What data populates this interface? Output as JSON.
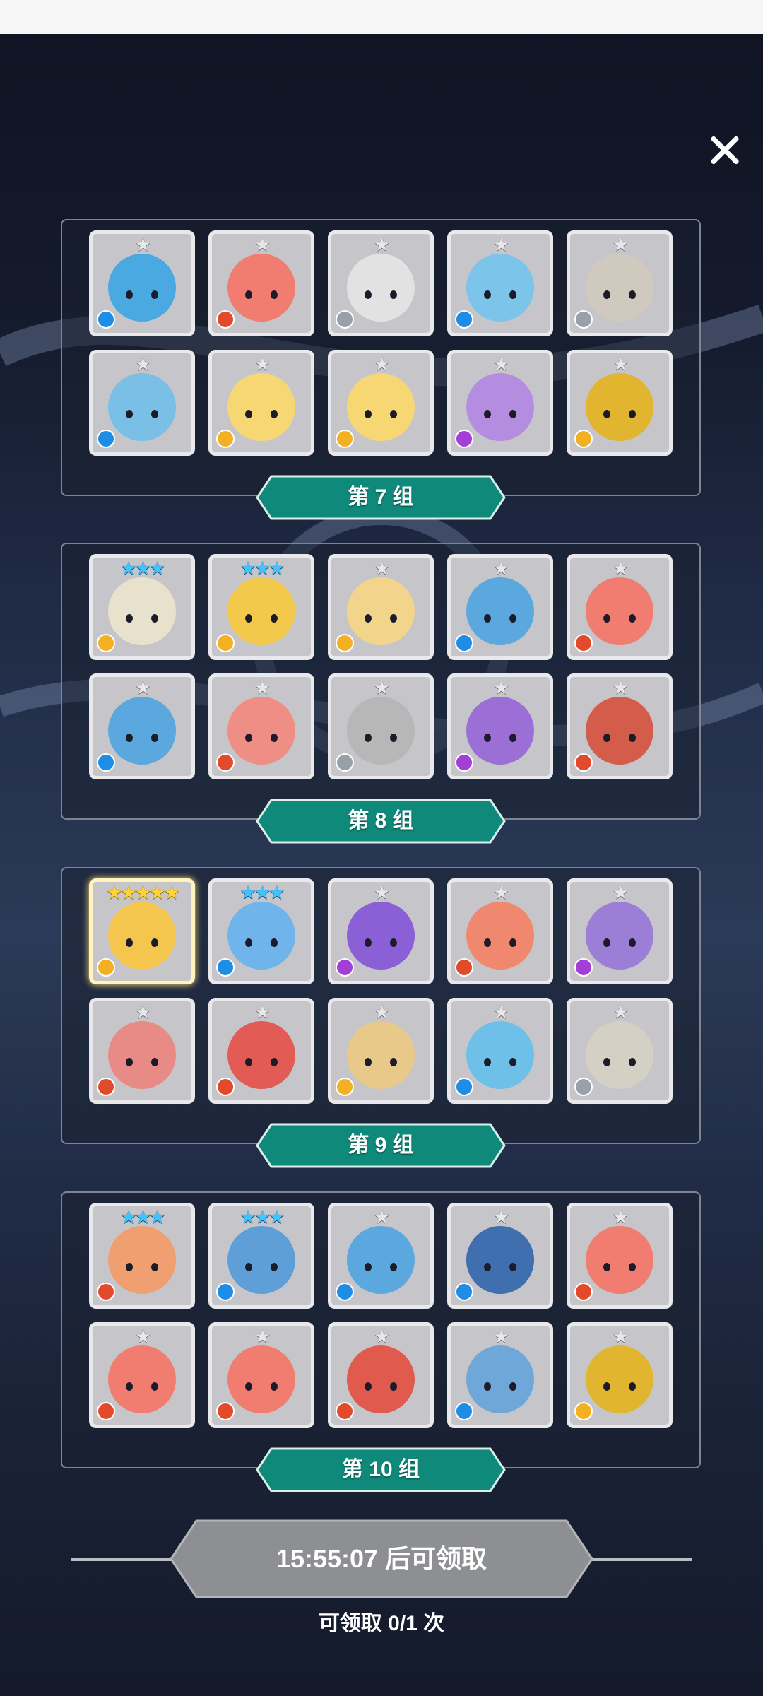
{
  "icons": {
    "close": "close-icon"
  },
  "claim": {
    "label": "15:55:07 后可领取",
    "count_text": "可领取 0/1 次"
  },
  "groups": [
    {
      "label": "第 7 组",
      "cards": [
        {
          "stars": 1,
          "star_color": "silver",
          "element": "water",
          "color": "#4aa9e0"
        },
        {
          "stars": 1,
          "star_color": "silver",
          "element": "fire",
          "color": "#f07d70"
        },
        {
          "stars": 1,
          "star_color": "silver",
          "element": "light",
          "color": "#e2e2e2"
        },
        {
          "stars": 1,
          "star_color": "silver",
          "element": "water",
          "color": "#7cc4ea"
        },
        {
          "stars": 1,
          "star_color": "silver",
          "element": "light",
          "color": "#cfcabd"
        },
        {
          "stars": 1,
          "star_color": "silver",
          "element": "water",
          "color": "#79bfe6"
        },
        {
          "stars": 1,
          "star_color": "silver",
          "element": "wind",
          "color": "#f6d774"
        },
        {
          "stars": 1,
          "star_color": "silver",
          "element": "wind",
          "color": "#f6d774"
        },
        {
          "stars": 1,
          "star_color": "silver",
          "element": "dark",
          "color": "#b58de0"
        },
        {
          "stars": 1,
          "star_color": "silver",
          "element": "wind",
          "color": "#e2b531"
        }
      ]
    },
    {
      "label": "第 8 组",
      "cards": [
        {
          "stars": 3,
          "star_color": "blue",
          "element": "wind",
          "color": "#e8e1cc"
        },
        {
          "stars": 3,
          "star_color": "blue",
          "element": "wind",
          "color": "#f2c94a"
        },
        {
          "stars": 1,
          "star_color": "silver",
          "element": "wind",
          "color": "#f2d48a"
        },
        {
          "stars": 1,
          "star_color": "silver",
          "element": "water",
          "color": "#5aa8de"
        },
        {
          "stars": 1,
          "star_color": "silver",
          "element": "fire",
          "color": "#f07d70"
        },
        {
          "stars": 1,
          "star_color": "silver",
          "element": "water",
          "color": "#5aa8de"
        },
        {
          "stars": 1,
          "star_color": "silver",
          "element": "fire",
          "color": "#ef8e84"
        },
        {
          "stars": 1,
          "star_color": "silver",
          "element": "light",
          "color": "#b7b7b7"
        },
        {
          "stars": 1,
          "star_color": "silver",
          "element": "dark",
          "color": "#9b6fd6"
        },
        {
          "stars": 1,
          "star_color": "silver",
          "element": "fire",
          "color": "#d35c4a"
        }
      ]
    },
    {
      "label": "第 9 组",
      "cards": [
        {
          "stars": 5,
          "star_color": "gold",
          "element": "wind",
          "color": "#f5c64e",
          "highlight": true
        },
        {
          "stars": 3,
          "star_color": "blue",
          "element": "water",
          "color": "#6fb4ea"
        },
        {
          "stars": 1,
          "star_color": "silver",
          "element": "dark",
          "color": "#8b5fd6"
        },
        {
          "stars": 1,
          "star_color": "silver",
          "element": "fire",
          "color": "#f08870"
        },
        {
          "stars": 1,
          "star_color": "silver",
          "element": "dark",
          "color": "#9b7fd6"
        },
        {
          "stars": 1,
          "star_color": "silver",
          "element": "fire",
          "color": "#e88b86"
        },
        {
          "stars": 1,
          "star_color": "silver",
          "element": "fire",
          "color": "#e25c55"
        },
        {
          "stars": 1,
          "star_color": "silver",
          "element": "wind",
          "color": "#e8c98a"
        },
        {
          "stars": 1,
          "star_color": "silver",
          "element": "water",
          "color": "#6fc0e8"
        },
        {
          "stars": 1,
          "star_color": "silver",
          "element": "light",
          "color": "#d4d0c4"
        }
      ]
    },
    {
      "label": "第 10 组",
      "cards": [
        {
          "stars": 3,
          "star_color": "blue",
          "element": "fire",
          "color": "#f0a070"
        },
        {
          "stars": 3,
          "star_color": "blue",
          "element": "water",
          "color": "#5f9fd8"
        },
        {
          "stars": 1,
          "star_color": "silver",
          "element": "water",
          "color": "#5aa8de"
        },
        {
          "stars": 1,
          "star_color": "silver",
          "element": "water",
          "color": "#3f6fae"
        },
        {
          "stars": 1,
          "star_color": "silver",
          "element": "fire",
          "color": "#f07d70"
        },
        {
          "stars": 1,
          "star_color": "silver",
          "element": "fire",
          "color": "#f07d70"
        },
        {
          "stars": 1,
          "star_color": "silver",
          "element": "fire",
          "color": "#f07d70"
        },
        {
          "stars": 1,
          "star_color": "silver",
          "element": "fire",
          "color": "#e05a4e"
        },
        {
          "stars": 1,
          "star_color": "silver",
          "element": "water",
          "color": "#6fa8d8"
        },
        {
          "stars": 1,
          "star_color": "silver",
          "element": "wind",
          "color": "#e2b531"
        }
      ]
    }
  ]
}
